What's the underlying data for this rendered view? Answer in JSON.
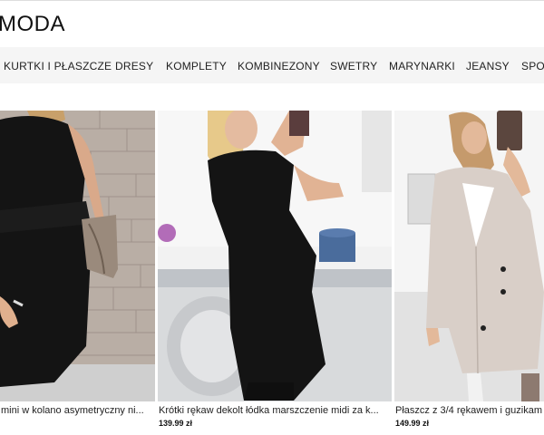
{
  "header": {
    "logo": "MODA"
  },
  "nav": {
    "items": [
      "KURTKI I PŁASZCZE",
      "DRESY",
      "KOMPLETY",
      "KOMBINEZONY",
      "SWETRY",
      "MARYNARKI",
      "JEANSY",
      "SPO"
    ]
  },
  "products": [
    {
      "title": "mini w kolano asymetryczny ni...",
      "price": ""
    },
    {
      "title": "Krótki rękaw dekolt łódka marszczenie midi za k...",
      "price": "139.99 zł"
    },
    {
      "title": "Płaszcz z 3/4 rękawem i guzikam",
      "price": "149.99 zł"
    }
  ],
  "colors": {
    "nav_bg": "#f5f5f5",
    "text": "#111111"
  }
}
